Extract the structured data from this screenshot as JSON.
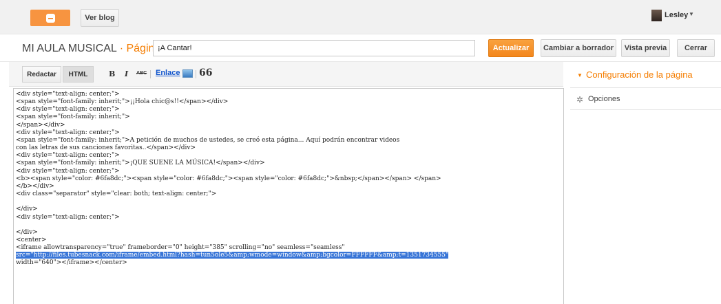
{
  "topbar": {
    "ver_blog": "Ver blog",
    "user_name": "Lesley"
  },
  "header": {
    "blog_name": "MI AULA MUSICAL",
    "separator": "·",
    "section": "Página",
    "title_value": "¡A Cantar!",
    "actualizar": "Actualizar",
    "cambiar_borrador": "Cambiar a borrador",
    "vista_previa": "Vista previa",
    "cerrar": "Cerrar"
  },
  "toolbar": {
    "redactar": "Redactar",
    "html": "HTML",
    "bold": "B",
    "italic": "I",
    "strike": "ABC",
    "link": "Enlace",
    "quote": "66"
  },
  "panel": {
    "config": "Configuración de la página",
    "opciones": "Opciones"
  },
  "editor": {
    "lines": [
      "<div style=\"text-align: center;\">",
      "<span style=\"font-family: inherit;\">¡¡Hola chic@s!!</span></div>",
      "<div style=\"text-align: center;\">",
      "<span style=\"font-family: inherit;\">",
      "</span></div>",
      "<div style=\"text-align: center;\">",
      "<span style=\"font-family: inherit;\">A petición de muchos de ustedes, se creó esta página... Aquí podrán encontrar videos",
      "con las letras de sus canciones favoritas..</span></div>",
      "<div style=\"text-align: center;\">",
      "<span style=\"font-family: inherit;\">¡QUE SUENE LA MÚSICA!</span></div>",
      "<div style=\"text-align: center;\">",
      "<b><span style=\"color: #6fa8dc;\"><span style=\"color: #6fa8dc;\"><span style=\"color: #6fa8dc;\">&nbsp;</span></span> </span>",
      "</b></div>",
      "<div class=\"separator\" style=\"clear: both; text-align: center;\">",
      "",
      "</div>",
      "<div style=\"text-align: center;\">",
      "",
      "</div>",
      "<center>",
      "<iframe allowtransparency=\"true\" frameborder=\"0\" height=\"385\" scrolling=\"no\" seamless=\"seamless\""
    ],
    "selected_line": "src=\"http://files.tubesnack.com/iframe/embed.html?hash=tun5ole5&amp;wmode=window&amp;bgcolor=FFFFFF&amp;t=1351734555\"",
    "last_line": "width=\"640\"></iframe></center>"
  }
}
